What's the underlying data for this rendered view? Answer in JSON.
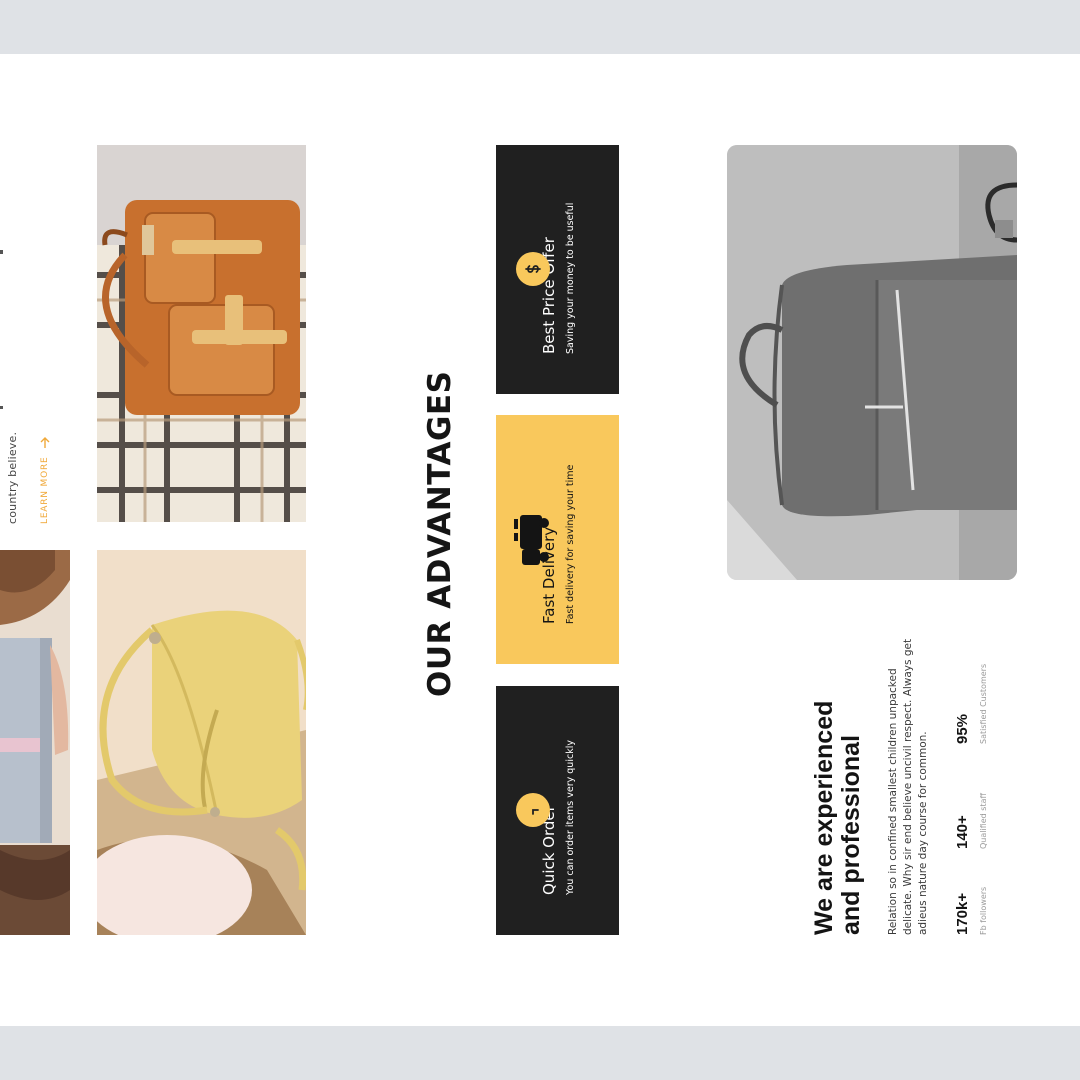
{
  "left_column": {
    "fragment_text": "country believe.",
    "learn_more_label": "LEARN MORE",
    "arrow_icon": "arrow-right-icon"
  },
  "advantages": {
    "heading": "OUR ADVANTAGES",
    "cards": [
      {
        "title": "Best Price Offer",
        "subtitle": "Saving your money to be useful",
        "icon": "dollar-icon",
        "bg": "#202020",
        "fg": "#ffffff",
        "icon_bg": "#f9c85c"
      },
      {
        "title": "Fast Delivery",
        "subtitle": "Fast delivery for saving your time",
        "icon": "truck-icon",
        "bg": "#f9c85c",
        "fg": "#141414",
        "icon_bg": "transparent"
      },
      {
        "title": "Quick Order",
        "subtitle": "You can order items very quickly",
        "icon": "clock-icon",
        "bg": "#202020",
        "fg": "#ffffff",
        "icon_bg": "#f9c85c"
      }
    ]
  },
  "about": {
    "title_line1": "We are experienced",
    "title_line2": "and professional",
    "body_line1": "Relation so in confined smallest children unpacked",
    "body_line2": "delicate. Why sir end believe uncivil respect. Always get",
    "body_line3": "adieus nature day course for common.",
    "stats": [
      {
        "value": "170k+",
        "label": "Fb followers"
      },
      {
        "value": "140+",
        "label": "Qualified staff"
      },
      {
        "value": "95%",
        "label": "Satisfied Customers"
      }
    ]
  },
  "colors": {
    "accent": "#f9c85c",
    "dark": "#202020",
    "frame": "#dfe2e6"
  }
}
